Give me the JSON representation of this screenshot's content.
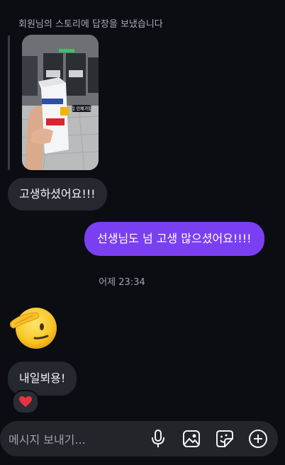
{
  "thread": {
    "story_reply_label": "회원님의 스토리에 답장을 보냈습니다",
    "story_sticker_text": "집 인체가림",
    "messages": [
      {
        "from": "them",
        "text": "고생하셨어요!!!"
      },
      {
        "from": "me",
        "text": "선생님도 넘 고생 많으셨어요!!!!"
      }
    ],
    "timestamp": "어제 23:34",
    "emoji_message": "salute",
    "last_message": {
      "from": "them",
      "text": "내일뵈용!",
      "reaction": "red-heart"
    }
  },
  "composer": {
    "placeholder": "메시지 보내기...",
    "icons": [
      "microphone-icon",
      "image-icon",
      "sticker-icon",
      "plus-icon"
    ]
  },
  "colors": {
    "background": "#0b0d12",
    "received_bubble": "#262830",
    "sent_bubble": "#7b3ff2",
    "composer": "#23252b",
    "heart": "#e8333f"
  }
}
